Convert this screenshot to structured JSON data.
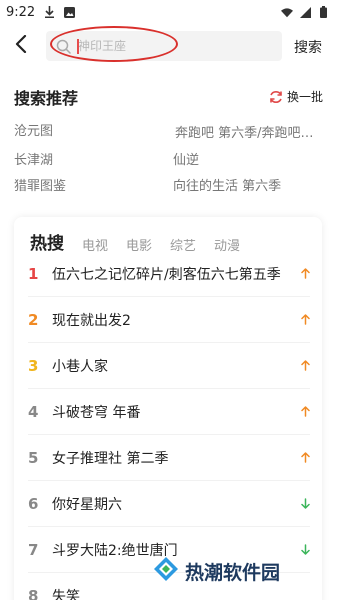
{
  "status_bar": {
    "time": "9:22",
    "left_icons": [
      "download-icon",
      "image-notification-icon"
    ],
    "right_icons": [
      "wifi-icon",
      "signal-icon",
      "battery-icon"
    ]
  },
  "search": {
    "placeholder": "神印王座",
    "submit_label": "搜索"
  },
  "recommendations": {
    "title": "搜索推荐",
    "refresh_label": "换一批",
    "items": [
      "沧元图",
      "奔跑吧 第六季/奔跑吧…",
      "长津湖",
      "仙逆",
      "猎罪图鉴",
      "向往的生活 第六季"
    ]
  },
  "hot": {
    "tabs": [
      "热搜",
      "电视",
      "电影",
      "综艺",
      "动漫"
    ],
    "items": [
      {
        "rank": "1",
        "title": "伍六七之记忆碎片/刺客伍六七第五季",
        "trend": "up"
      },
      {
        "rank": "2",
        "title": "现在就出发2",
        "trend": "up"
      },
      {
        "rank": "3",
        "title": "小巷人家",
        "trend": "up"
      },
      {
        "rank": "4",
        "title": "斗破苍穹 年番",
        "trend": "up"
      },
      {
        "rank": "5",
        "title": "女子推理社 第二季",
        "trend": "up"
      },
      {
        "rank": "6",
        "title": "你好星期六",
        "trend": "down"
      },
      {
        "rank": "7",
        "title": "斗罗大陆2:绝世唐门",
        "trend": "down"
      },
      {
        "rank": "8",
        "title": "失笑",
        "trend": ""
      }
    ]
  },
  "watermark": {
    "text": "热潮软件园"
  },
  "colors": {
    "rank_1": "#e64545",
    "rank_2": "#f08a24",
    "rank_3": "#f0b51e",
    "rank_other": "#888888",
    "trend_up": "#f08a24",
    "trend_down": "#3bb55a",
    "annotation": "#d9302c"
  }
}
